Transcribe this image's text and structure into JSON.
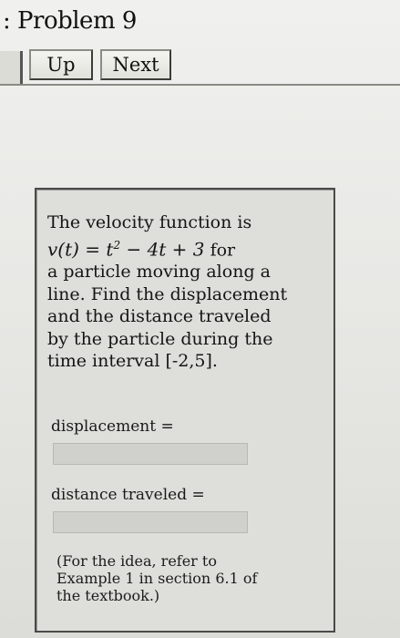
{
  "header": {
    "title": ": Problem 9"
  },
  "nav": {
    "up_label": "Up",
    "next_label": "Next"
  },
  "problem": {
    "text_intro": "The velocity function is",
    "equation_lhs": "v(t) = t",
    "equation_exp": "2",
    "equation_rhs": " − 4t + 3",
    "text_for": " for",
    "text_body_1": "a particle moving along a",
    "text_body_2": "line. Find the displacement",
    "text_body_3": "and the distance traveled",
    "text_body_4": "by the particle during the",
    "text_body_5": "time interval [-2,5]."
  },
  "answers": {
    "displacement_label": "displacement =",
    "displacement_value": "",
    "distance_label": "distance traveled =",
    "distance_value": ""
  },
  "hint": {
    "line_1": "(For the idea, refer to",
    "line_2": "Example 1 in section 6.1 of",
    "line_3": "the textbook.)"
  }
}
